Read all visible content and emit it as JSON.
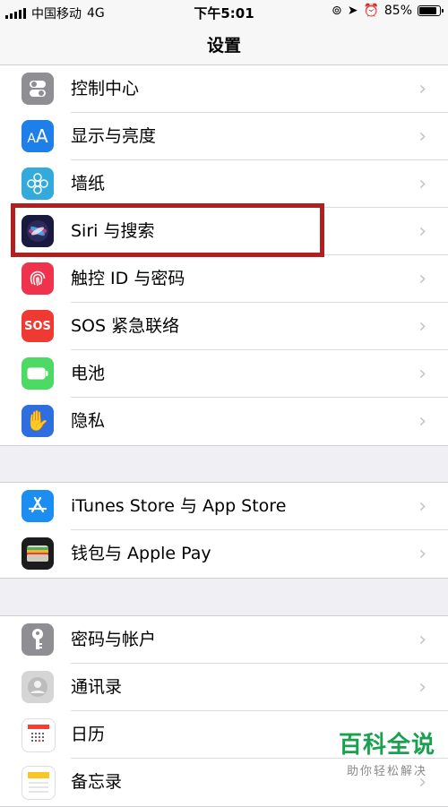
{
  "status_bar": {
    "carrier": "中国移动",
    "network": "4G",
    "time": "下午5:01",
    "battery_percent": "85%",
    "battery_level": 0.85
  },
  "navbar": {
    "title": "设置"
  },
  "groups": [
    {
      "items": [
        {
          "label": "控制中心",
          "icon": "toggle-switches-icon",
          "color": "#8e8e93"
        },
        {
          "label": "显示与亮度",
          "icon": "text-size-icon",
          "color": "#1f7fe8"
        },
        {
          "label": "墙纸",
          "icon": "flower-icon",
          "color": "#34aadc"
        },
        {
          "label": "Siri 与搜索",
          "icon": "siri-icon",
          "color": "#1a1a40"
        },
        {
          "label": "触控 ID 与密码",
          "icon": "fingerprint-icon",
          "color": "#f0334d"
        },
        {
          "label": "SOS 紧急联络",
          "icon": "sos-icon",
          "color": "#ee3a33",
          "icon_text": "SOS"
        },
        {
          "label": "电池",
          "icon": "battery-icon",
          "color": "#4cd964"
        },
        {
          "label": "隐私",
          "icon": "hand-icon",
          "color": "#2f6ee0"
        }
      ]
    },
    {
      "items": [
        {
          "label": "iTunes Store 与 App Store",
          "icon": "app-store-icon",
          "color": "#1c8ef2"
        },
        {
          "label": "钱包与 Apple Pay",
          "icon": "wallet-icon",
          "color": "#1c1c1e"
        }
      ]
    },
    {
      "items": [
        {
          "label": "密码与帐户",
          "icon": "key-icon",
          "color": "#8e8e93"
        },
        {
          "label": "通讯录",
          "icon": "contacts-icon",
          "color": "#d5d5d5"
        },
        {
          "label": "日历",
          "icon": "calendar-icon",
          "color": "#ffffff"
        },
        {
          "label": "备忘录",
          "icon": "notes-icon",
          "color": "#ffffff"
        }
      ]
    }
  ],
  "watermark": {
    "title": "百科全说",
    "subtitle": "助你轻松解决"
  }
}
